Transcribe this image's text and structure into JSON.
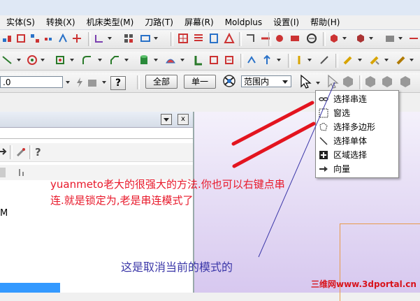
{
  "menubar": {
    "items": [
      "实体(S)",
      "转换(X)",
      "机床类型(M)",
      "刀路(T)",
      "屏幕(R)",
      "Moldplus",
      "设置(I)",
      "帮助(H)"
    ]
  },
  "selection_bar": {
    "value_field": ".0",
    "all_button": "全部",
    "single_button": "单一",
    "scope_select": "范围内",
    "help_glyph": "?"
  },
  "left_panel": {
    "letter": "M"
  },
  "dropdown": {
    "items": [
      {
        "label": "选择串连",
        "icon": "chain-icon"
      },
      {
        "label": "窗选",
        "icon": "window-select-icon"
      },
      {
        "label": "选择多边形",
        "icon": "polygon-select-icon"
      },
      {
        "label": "选择单体",
        "icon": "single-select-icon"
      },
      {
        "label": "区域选择",
        "icon": "area-select-icon"
      },
      {
        "label": "向量",
        "icon": "vector-icon"
      }
    ]
  },
  "annotations": {
    "red_note_line1": "yuanmeto老大的很强大的方法.你也可以右键点串",
    "red_note_line2": "连.就是锁定为,老是串连模式了",
    "blue_note": "这是取消当前的模式的",
    "watermark": "三维网www.3dportal.cn"
  },
  "colors": {
    "red_text": "#e8182a",
    "blue_text": "#3b37a8",
    "watermark": "#d8141c"
  }
}
